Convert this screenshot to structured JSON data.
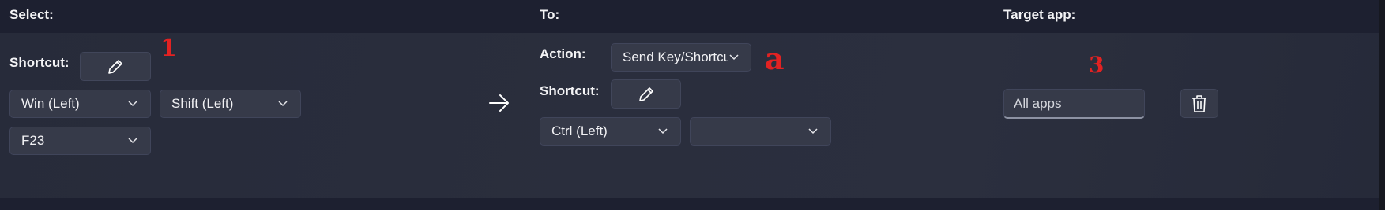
{
  "headers": {
    "select": "Select:",
    "to": "To:",
    "target_app": "Target app:"
  },
  "select": {
    "shortcut_label": "Shortcut:",
    "edit_icon": "pencil-icon",
    "keys": [
      "Win (Left)",
      "Shift (Left)",
      "F23"
    ]
  },
  "arrow_icon": "arrow-right-icon",
  "to": {
    "action_label": "Action:",
    "action_value": "Send Key/Shortcu",
    "shortcut_label": "Shortcut:",
    "edit_icon": "pencil-icon",
    "keys": [
      "Ctrl (Left)",
      ""
    ]
  },
  "target": {
    "placeholder": "All apps",
    "delete_icon": "trash-icon"
  },
  "annotations": [
    "1",
    "a",
    "3"
  ],
  "colors": {
    "background": "#1f2230",
    "panel": "#2a2e3d",
    "control": "#363a49",
    "annotation": "#e22222"
  }
}
